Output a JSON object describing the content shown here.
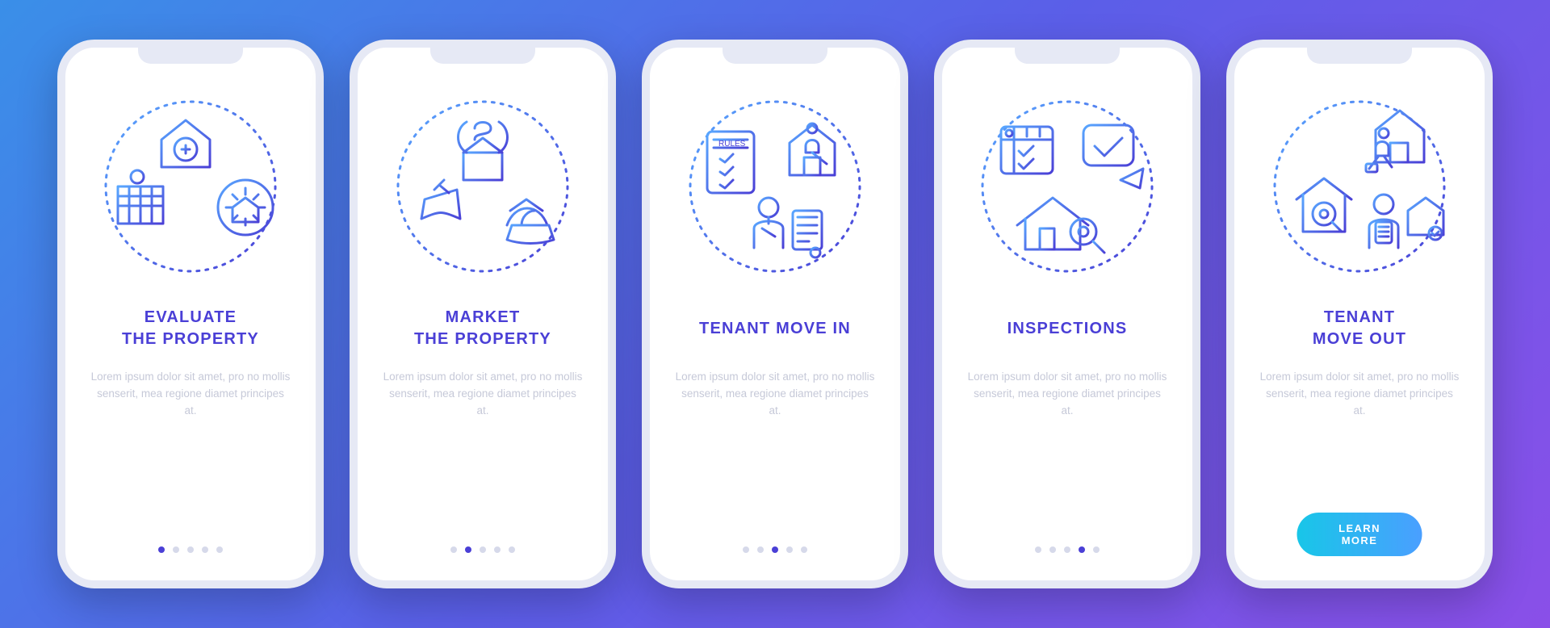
{
  "screens": [
    {
      "icon": "evaluate-property-icon",
      "title": "EVALUATE\nTHE PROPERTY",
      "desc": "Lorem ipsum dolor sit amet, pro no mollis senserit, mea regione diamet principes at.",
      "activeDot": 0
    },
    {
      "icon": "market-property-icon",
      "title": "MARKET\nTHE PROPERTY",
      "desc": "Lorem ipsum dolor sit amet, pro no mollis senserit, mea regione diamet principes at.",
      "activeDot": 1
    },
    {
      "icon": "tenant-move-in-icon",
      "title": "TENANT MOVE IN",
      "desc": "Lorem ipsum dolor sit amet, pro no mollis senserit, mea regione diamet principes at.",
      "activeDot": 2
    },
    {
      "icon": "inspections-icon",
      "title": "INSPECTIONS",
      "desc": "Lorem ipsum dolor sit amet, pro no mollis senserit, mea regione diamet principes at.",
      "activeDot": 3
    },
    {
      "icon": "tenant-move-out-icon",
      "title": "TENANT\nMOVE OUT",
      "desc": "Lorem ipsum dolor sit amet, pro no mollis senserit, mea regione diamet principes at.",
      "activeDot": 4,
      "cta": "LEARN MORE"
    }
  ],
  "totalDots": 5,
  "colors": {
    "accent": "#4a3fd6",
    "gradientStart": "#3a8fe8",
    "gradientEnd": "#8a4fe8",
    "ctaStart": "#18c6e8",
    "ctaEnd": "#4a9fff"
  }
}
